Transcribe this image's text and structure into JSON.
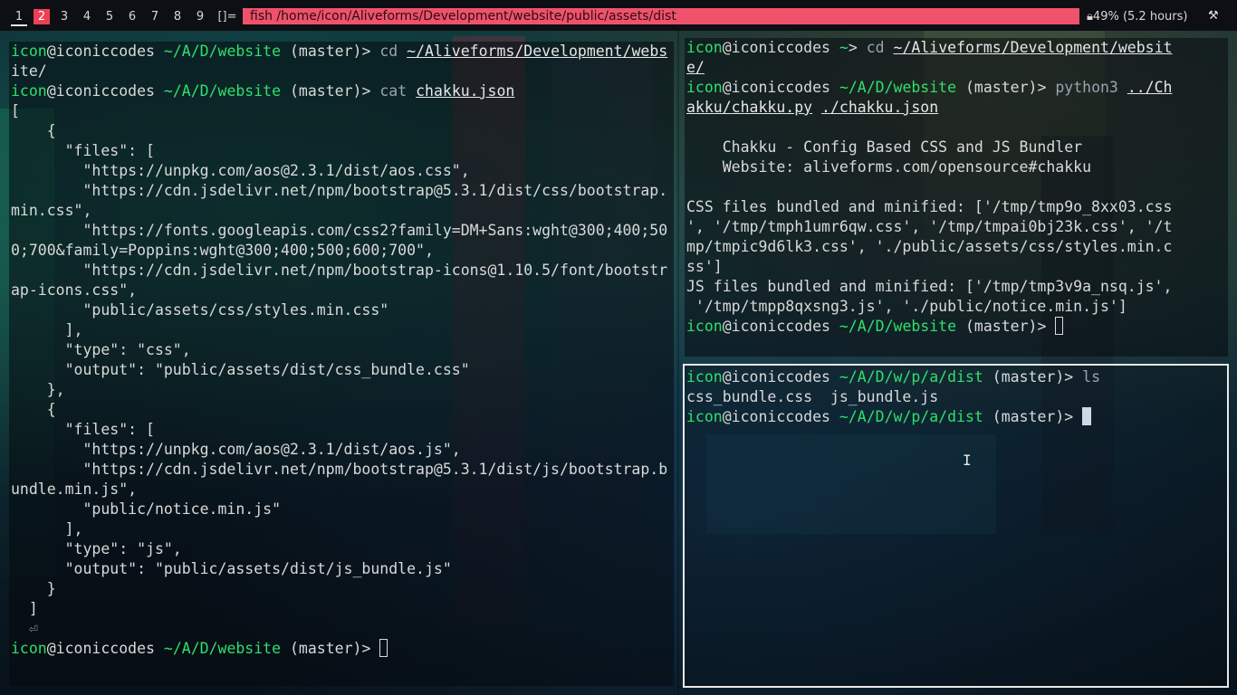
{
  "topbar": {
    "workspaces": [
      "1",
      "2",
      "3",
      "4",
      "5",
      "6",
      "7",
      "8",
      "9"
    ],
    "active_workspace": "2",
    "layout_symbol": "[]=",
    "window_title": "fish /home/icon/Aliveforms/Development/website/public/assets/dist",
    "battery": "49% (5.2 hours)",
    "battery_icon": "lock-battery-icon",
    "tray_icon": "tools-icon"
  },
  "left_pane": {
    "lines": [
      {
        "type": "prompt",
        "user": "icon",
        "host": "@iconiccodes",
        "path": " ~/A/D/website",
        "branch": " (master)",
        "sym": "> ",
        "cmd": "cd ",
        "arg": "~/Aliveforms/Development/webs"
      },
      {
        "type": "text",
        "text": "ite/"
      },
      {
        "type": "prompt",
        "user": "icon",
        "host": "@iconiccodes",
        "path": " ~/A/D/website",
        "branch": " (master)",
        "sym": "> ",
        "cmd": "cat ",
        "arg": "chakku.json"
      },
      {
        "type": "text",
        "text": "["
      },
      {
        "type": "text",
        "text": "    {"
      },
      {
        "type": "text",
        "text": "      \"files\": ["
      },
      {
        "type": "text",
        "text": "        \"https://unpkg.com/aos@2.3.1/dist/aos.css\","
      },
      {
        "type": "text",
        "text": "        \"https://cdn.jsdelivr.net/npm/bootstrap@5.3.1/dist/css/bootstrap."
      },
      {
        "type": "text",
        "text": "min.css\","
      },
      {
        "type": "text",
        "text": "        \"https://fonts.googleapis.com/css2?family=DM+Sans:wght@300;400;50"
      },
      {
        "type": "text",
        "text": "0;700&family=Poppins:wght@300;400;500;600;700\","
      },
      {
        "type": "text",
        "text": "        \"https://cdn.jsdelivr.net/npm/bootstrap-icons@1.10.5/font/bootstr"
      },
      {
        "type": "text",
        "text": "ap-icons.css\","
      },
      {
        "type": "text",
        "text": "        \"public/assets/css/styles.min.css\""
      },
      {
        "type": "text",
        "text": "      ],"
      },
      {
        "type": "text",
        "text": "      \"type\": \"css\","
      },
      {
        "type": "text",
        "text": "      \"output\": \"public/assets/dist/css_bundle.css\""
      },
      {
        "type": "text",
        "text": "    },"
      },
      {
        "type": "text",
        "text": "    {"
      },
      {
        "type": "text",
        "text": "      \"files\": ["
      },
      {
        "type": "text",
        "text": "        \"https://unpkg.com/aos@2.3.1/dist/aos.js\","
      },
      {
        "type": "text",
        "text": "        \"https://cdn.jsdelivr.net/npm/bootstrap@5.3.1/dist/js/bootstrap.b"
      },
      {
        "type": "text",
        "text": "undle.min.js\","
      },
      {
        "type": "text",
        "text": "        \"public/notice.min.js\""
      },
      {
        "type": "text",
        "text": "      ],"
      },
      {
        "type": "text",
        "text": "      \"type\": \"js\","
      },
      {
        "type": "text",
        "text": "      \"output\": \"public/assets/dist/js_bundle.js\""
      },
      {
        "type": "text",
        "text": "    }"
      },
      {
        "type": "text",
        "text": "  ]"
      },
      {
        "type": "dim",
        "text": "  ⏎"
      },
      {
        "type": "prompt",
        "user": "icon",
        "host": "@iconiccodes",
        "path": " ~/A/D/website",
        "branch": " (master)",
        "sym": "> ",
        "cmd": "",
        "arg": "",
        "cursor": "box"
      }
    ]
  },
  "top_right_pane": {
    "lines": [
      {
        "type": "prompt",
        "user": "icon",
        "host": "@iconiccodes",
        "path": " ~",
        "branch": "",
        "sym": "> ",
        "cmd": "cd ",
        "arg": "~/Aliveforms/Development/websit"
      },
      {
        "type": "ul",
        "text": "e/"
      },
      {
        "type": "prompt",
        "user": "icon",
        "host": "@iconiccodes",
        "path": " ~/A/D/website",
        "branch": " (master)",
        "sym": "> ",
        "cmd": "python3 ",
        "arg": "../Ch"
      },
      {
        "type": "ul2",
        "a": "akku/chakku.py",
        "b": " ",
        "c": "./chakku.json"
      },
      {
        "type": "text",
        "text": ""
      },
      {
        "type": "text",
        "text": "    Chakku - Config Based CSS and JS Bundler"
      },
      {
        "type": "text",
        "text": "    Website: aliveforms.com/opensource#chakku"
      },
      {
        "type": "text",
        "text": ""
      },
      {
        "type": "text",
        "text": "CSS files bundled and minified: ['/tmp/tmp9o_8xx03.css"
      },
      {
        "type": "text",
        "text": "', '/tmp/tmph1umr6qw.css', '/tmp/tmpai0bj23k.css', '/t"
      },
      {
        "type": "text",
        "text": "mp/tmpic9d6lk3.css', './public/assets/css/styles.min.c"
      },
      {
        "type": "text",
        "text": "ss']"
      },
      {
        "type": "text",
        "text": "JS files bundled and minified: ['/tmp/tmp3v9a_nsq.js',"
      },
      {
        "type": "text",
        "text": " '/tmp/tmpp8qxsng3.js', './public/notice.min.js']"
      },
      {
        "type": "prompt",
        "user": "icon",
        "host": "@iconiccodes",
        "path": " ~/A/D/website",
        "branch": " (master)",
        "sym": "> ",
        "cmd": "",
        "arg": "",
        "cursor": "box"
      }
    ]
  },
  "bottom_right_pane": {
    "lines": [
      {
        "type": "prompt",
        "user": "icon",
        "host": "@iconiccodes",
        "path": " ~/A/D/w/p/a/dist",
        "branch": " (master)",
        "sym": "> ",
        "cmd": "ls",
        "arg": ""
      },
      {
        "type": "text",
        "text": "css_bundle.css  js_bundle.js"
      },
      {
        "type": "prompt",
        "user": "icon",
        "host": "@iconiccodes",
        "path": " ~/A/D/w/p/a/dist",
        "branch": " (master)",
        "sym": "> ",
        "cmd": "",
        "arg": "",
        "cursor": "solid"
      }
    ]
  },
  "colors": {
    "accent": "#ee4053",
    "title_strip": "#f0526b",
    "prompt_green": "#2ee06b",
    "text": "#d9d9d9"
  },
  "mouse": {
    "icon": "ibeam-cursor-icon"
  }
}
